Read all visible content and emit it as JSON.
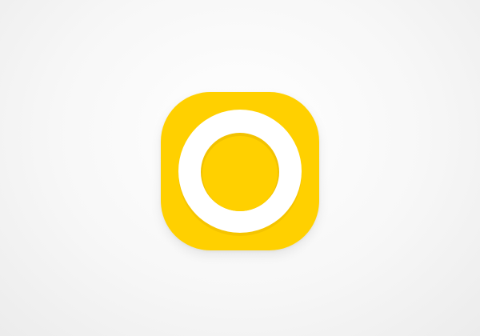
{
  "icon": {
    "name": "circle-ring-icon",
    "colors": {
      "background": "#ffffff",
      "tile": "#ffd000",
      "tile_shadow": "#f5c400",
      "ring": "#ffffff",
      "center": "#ffd000",
      "center_shadow": "#f2c200"
    }
  }
}
